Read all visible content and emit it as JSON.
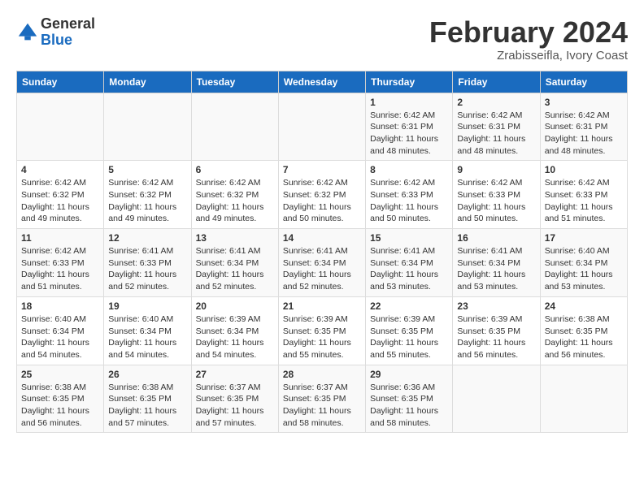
{
  "header": {
    "logo": {
      "general": "General",
      "blue": "Blue"
    },
    "title": "February 2024",
    "location": "Zrabisseifla, Ivory Coast"
  },
  "weekdays": [
    "Sunday",
    "Monday",
    "Tuesday",
    "Wednesday",
    "Thursday",
    "Friday",
    "Saturday"
  ],
  "weeks": [
    [
      {
        "day": "",
        "info": ""
      },
      {
        "day": "",
        "info": ""
      },
      {
        "day": "",
        "info": ""
      },
      {
        "day": "",
        "info": ""
      },
      {
        "day": "1",
        "info": "Sunrise: 6:42 AM\nSunset: 6:31 PM\nDaylight: 11 hours\nand 48 minutes."
      },
      {
        "day": "2",
        "info": "Sunrise: 6:42 AM\nSunset: 6:31 PM\nDaylight: 11 hours\nand 48 minutes."
      },
      {
        "day": "3",
        "info": "Sunrise: 6:42 AM\nSunset: 6:31 PM\nDaylight: 11 hours\nand 48 minutes."
      }
    ],
    [
      {
        "day": "4",
        "info": "Sunrise: 6:42 AM\nSunset: 6:32 PM\nDaylight: 11 hours\nand 49 minutes."
      },
      {
        "day": "5",
        "info": "Sunrise: 6:42 AM\nSunset: 6:32 PM\nDaylight: 11 hours\nand 49 minutes."
      },
      {
        "day": "6",
        "info": "Sunrise: 6:42 AM\nSunset: 6:32 PM\nDaylight: 11 hours\nand 49 minutes."
      },
      {
        "day": "7",
        "info": "Sunrise: 6:42 AM\nSunset: 6:32 PM\nDaylight: 11 hours\nand 50 minutes."
      },
      {
        "day": "8",
        "info": "Sunrise: 6:42 AM\nSunset: 6:33 PM\nDaylight: 11 hours\nand 50 minutes."
      },
      {
        "day": "9",
        "info": "Sunrise: 6:42 AM\nSunset: 6:33 PM\nDaylight: 11 hours\nand 50 minutes."
      },
      {
        "day": "10",
        "info": "Sunrise: 6:42 AM\nSunset: 6:33 PM\nDaylight: 11 hours\nand 51 minutes."
      }
    ],
    [
      {
        "day": "11",
        "info": "Sunrise: 6:42 AM\nSunset: 6:33 PM\nDaylight: 11 hours\nand 51 minutes."
      },
      {
        "day": "12",
        "info": "Sunrise: 6:41 AM\nSunset: 6:33 PM\nDaylight: 11 hours\nand 52 minutes."
      },
      {
        "day": "13",
        "info": "Sunrise: 6:41 AM\nSunset: 6:34 PM\nDaylight: 11 hours\nand 52 minutes."
      },
      {
        "day": "14",
        "info": "Sunrise: 6:41 AM\nSunset: 6:34 PM\nDaylight: 11 hours\nand 52 minutes."
      },
      {
        "day": "15",
        "info": "Sunrise: 6:41 AM\nSunset: 6:34 PM\nDaylight: 11 hours\nand 53 minutes."
      },
      {
        "day": "16",
        "info": "Sunrise: 6:41 AM\nSunset: 6:34 PM\nDaylight: 11 hours\nand 53 minutes."
      },
      {
        "day": "17",
        "info": "Sunrise: 6:40 AM\nSunset: 6:34 PM\nDaylight: 11 hours\nand 53 minutes."
      }
    ],
    [
      {
        "day": "18",
        "info": "Sunrise: 6:40 AM\nSunset: 6:34 PM\nDaylight: 11 hours\nand 54 minutes."
      },
      {
        "day": "19",
        "info": "Sunrise: 6:40 AM\nSunset: 6:34 PM\nDaylight: 11 hours\nand 54 minutes."
      },
      {
        "day": "20",
        "info": "Sunrise: 6:39 AM\nSunset: 6:34 PM\nDaylight: 11 hours\nand 54 minutes."
      },
      {
        "day": "21",
        "info": "Sunrise: 6:39 AM\nSunset: 6:35 PM\nDaylight: 11 hours\nand 55 minutes."
      },
      {
        "day": "22",
        "info": "Sunrise: 6:39 AM\nSunset: 6:35 PM\nDaylight: 11 hours\nand 55 minutes."
      },
      {
        "day": "23",
        "info": "Sunrise: 6:39 AM\nSunset: 6:35 PM\nDaylight: 11 hours\nand 56 minutes."
      },
      {
        "day": "24",
        "info": "Sunrise: 6:38 AM\nSunset: 6:35 PM\nDaylight: 11 hours\nand 56 minutes."
      }
    ],
    [
      {
        "day": "25",
        "info": "Sunrise: 6:38 AM\nSunset: 6:35 PM\nDaylight: 11 hours\nand 56 minutes."
      },
      {
        "day": "26",
        "info": "Sunrise: 6:38 AM\nSunset: 6:35 PM\nDaylight: 11 hours\nand 57 minutes."
      },
      {
        "day": "27",
        "info": "Sunrise: 6:37 AM\nSunset: 6:35 PM\nDaylight: 11 hours\nand 57 minutes."
      },
      {
        "day": "28",
        "info": "Sunrise: 6:37 AM\nSunset: 6:35 PM\nDaylight: 11 hours\nand 58 minutes."
      },
      {
        "day": "29",
        "info": "Sunrise: 6:36 AM\nSunset: 6:35 PM\nDaylight: 11 hours\nand 58 minutes."
      },
      {
        "day": "",
        "info": ""
      },
      {
        "day": "",
        "info": ""
      }
    ]
  ]
}
